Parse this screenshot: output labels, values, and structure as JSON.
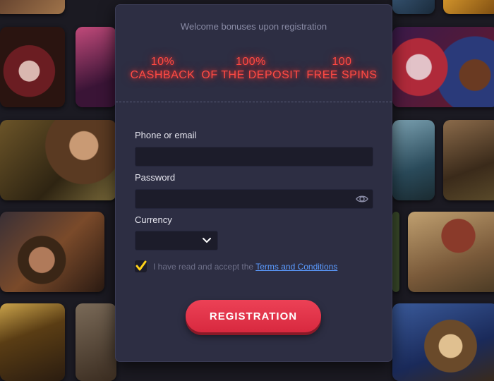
{
  "modal": {
    "welcome_text": "Welcome bonuses upon registration",
    "bonuses": [
      {
        "line1": "10%",
        "line2": "CASHBACK"
      },
      {
        "line1": "100%",
        "line2": "OF THE DEPOSIT"
      },
      {
        "line1": "100",
        "line2": "FREE SPINS"
      }
    ],
    "phone_label": "Phone or email",
    "phone_value": "",
    "password_label": "Password",
    "password_value": "",
    "currency_label": "Currency",
    "currency_value": "",
    "terms_prefix": "I have read and accept the",
    "terms_link": "Terms and Conditions",
    "terms_checked": true,
    "register_button": "REGISTRATION"
  },
  "colors": {
    "modal_bg": "#2d2e43",
    "neon_red": "#ff4a44",
    "button_red": "#e23a4f",
    "checkbox_check": "#ffd21a",
    "link": "#5b9bff"
  },
  "icons": [
    "eye-icon",
    "chevron-down-icon",
    "checkmark-icon"
  ]
}
